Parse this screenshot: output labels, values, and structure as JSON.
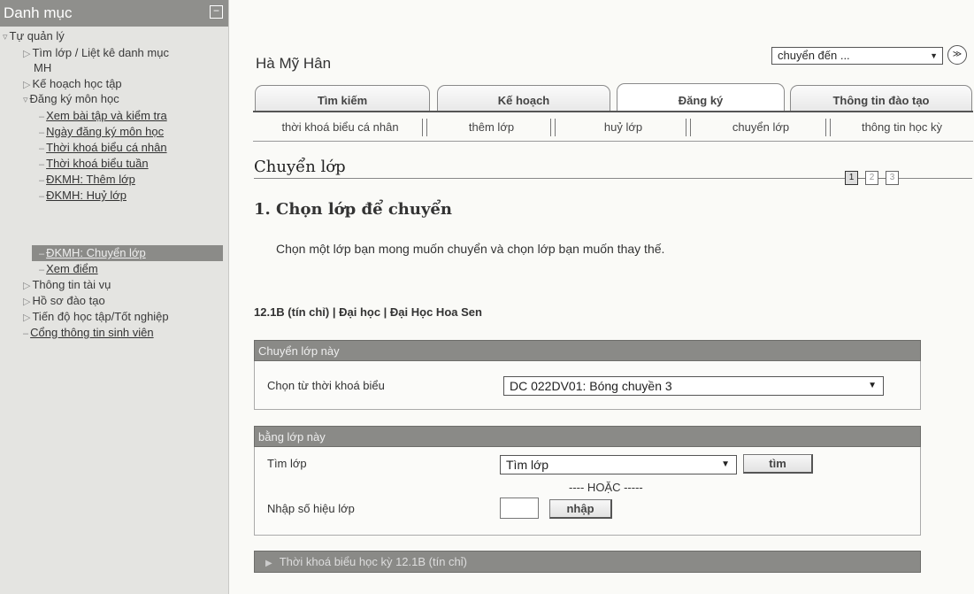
{
  "sidebar": {
    "title": "Danh mục",
    "collapse_glyph": "−",
    "items": [
      {
        "label": "Tự quản lý",
        "glyph": "▿"
      },
      {
        "label": "Tìm lớp / Liệt kê danh mục",
        "glyph": "▷"
      },
      {
        "label": "MH"
      },
      {
        "label": "Kế hoạch học tập",
        "glyph": "▷"
      },
      {
        "label": "Đăng ký môn học",
        "glyph": "▿"
      },
      {
        "label": "Xem bài tập và kiểm tra"
      },
      {
        "label": "Ngày đăng ký môn học"
      },
      {
        "label": "Thời khoá biểu cá nhân"
      },
      {
        "label": "Thời khoá biểu tuần"
      },
      {
        "label": "ĐKMH: Thêm lớp"
      },
      {
        "label": "ĐKMH: Huỷ lớp"
      },
      {
        "label": "ĐKMH: Chuyển lớp"
      },
      {
        "label": "Xem điểm"
      },
      {
        "label": "Thông tin tài vụ",
        "glyph": "▷"
      },
      {
        "label": "Hồ sơ đào tạo",
        "glyph": "▷"
      },
      {
        "label": "Tiến độ học tập/Tốt nghiệp",
        "glyph": "▷"
      },
      {
        "label": "Cổng thông tin sinh viên"
      }
    ]
  },
  "header": {
    "user_name": "Hà Mỹ Hân",
    "jump_select": "chuyển đến ...",
    "jump_go": "≫"
  },
  "tabs": [
    {
      "label": "Tìm kiếm"
    },
    {
      "label": "Kế hoạch"
    },
    {
      "label": "Đăng ký"
    },
    {
      "label": "Thông tin đào tạo"
    }
  ],
  "subtabs": [
    {
      "label": "thời khoá biểu cá nhân"
    },
    {
      "label": "thêm lớp"
    },
    {
      "label": "huỷ lớp"
    },
    {
      "label": "chuyển lớp"
    },
    {
      "label": "thông tin học kỳ"
    }
  ],
  "main": {
    "page_title": "Chuyển lớp",
    "steps": [
      "1",
      "2",
      "3"
    ],
    "section_title": "1. Chọn lớp để chuyển",
    "instruction": "Chọn một lớp bạn mong muốn chuyển và chọn lớp bạn muốn thay thế.",
    "course_info": "12.1B (tín chỉ) | Đại học | Đại Học Hoa Sen"
  },
  "panel_from": {
    "header": "Chuyển lớp này",
    "label": "Chọn từ thời khoá biểu",
    "selected": "DC 022DV01: Bóng chuyền 3"
  },
  "panel_to": {
    "header": "bằng lớp này",
    "find_label": "Tìm lớp",
    "find_selected": "Tìm lớp",
    "find_button": "tìm",
    "or_text": "---- HOẶC -----",
    "enter_label": "Nhập số hiệu lớp",
    "enter_button": "nhập"
  },
  "schedule_bar": {
    "label": "Thời khoá biểu học kỳ 12.1B (tín chỉ)"
  },
  "icons": {
    "dropdown": "▼",
    "expand": "▶"
  }
}
